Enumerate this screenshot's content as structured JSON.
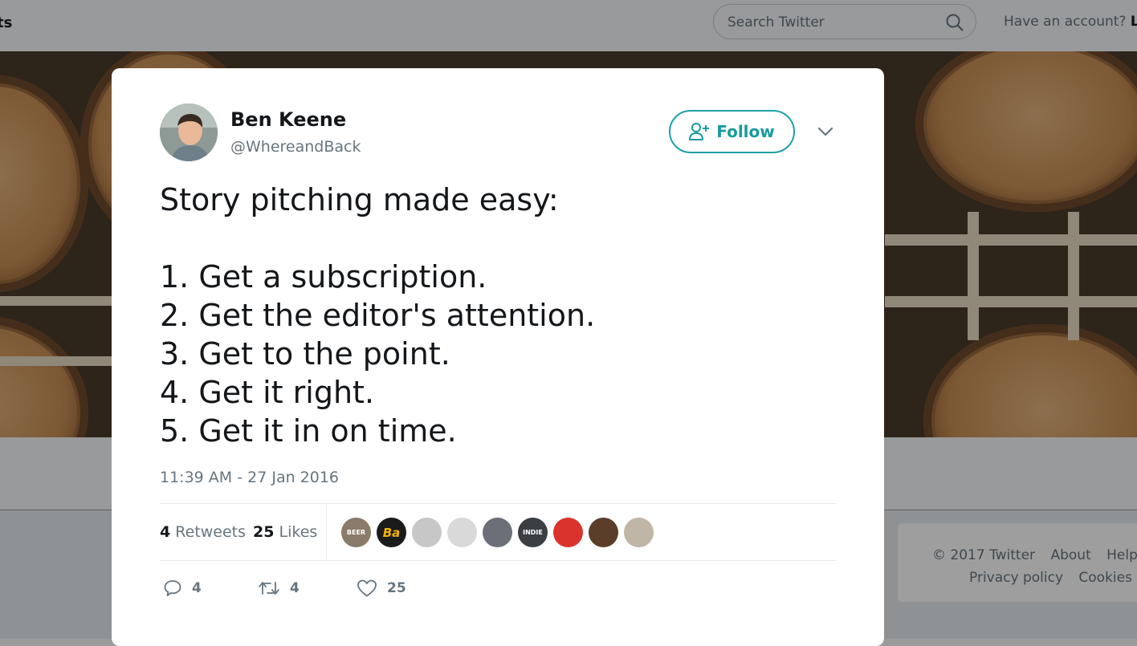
{
  "topbar": {
    "nav_fragment": "ts",
    "search_placeholder": "Search Twitter",
    "account_prompt": "Have an account?",
    "login_fragment": "Lo"
  },
  "footer": {
    "copyright": "© 2017 Twitter",
    "about": "About",
    "help": "Help C",
    "privacy": "Privacy policy",
    "cookies": "Cookies",
    "more": "A"
  },
  "tweet": {
    "author_name": "Ben Keene",
    "author_handle": "@WhereandBack",
    "follow_label": "Follow",
    "text": "Story pitching made easy:\n\n1. Get a subscription.\n2. Get the editor's attention.\n3. Get to the point.\n4. Get it right.\n5. Get it in on time.",
    "timestamp": "11:39 AM - 27 Jan 2016",
    "retweet_count": "4",
    "retweets_label": "Retweets",
    "like_count": "25",
    "likes_label": "Likes",
    "likers": [
      {
        "initials": "BEER",
        "color": "#8a7b6a"
      },
      {
        "initials": "Ba",
        "color": "#1b1b1b"
      },
      {
        "initials": "",
        "color": "#c7c7c7"
      },
      {
        "initials": "",
        "color": "#d9d9d9"
      },
      {
        "initials": "",
        "color": "#6a6f78"
      },
      {
        "initials": "INDIE",
        "color": "#3a3f44"
      },
      {
        "initials": "",
        "color": "#d9332b"
      },
      {
        "initials": "",
        "color": "#5a3e2a"
      },
      {
        "initials": "",
        "color": "#bfb6a8"
      }
    ],
    "actions": {
      "reply_count": "4",
      "retweet_count": "4",
      "like_count": "25"
    }
  },
  "colors": {
    "accent": "#1da1a6",
    "text": "#14171a",
    "muted": "#66757f"
  }
}
